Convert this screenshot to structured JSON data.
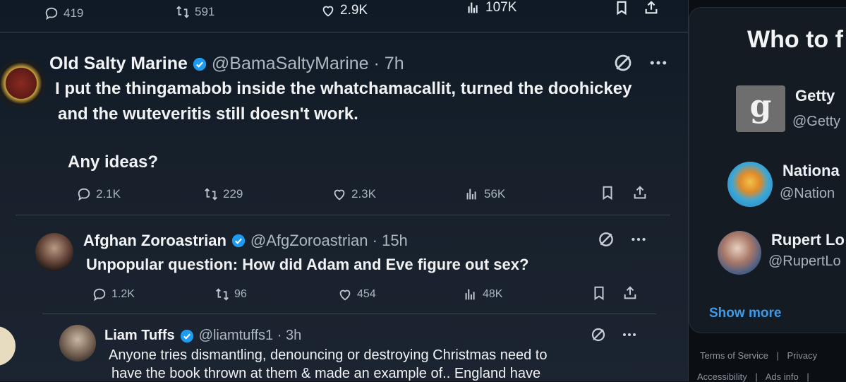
{
  "top_bar": {
    "replies": "419",
    "reposts": "591",
    "likes": "2.9K",
    "views": "107K"
  },
  "tweets": [
    {
      "name": "Old Salty Marine",
      "handle": "@BamaSaltyMarine · 7h",
      "text_line1": "I put the thingamabob inside the whatchamacallit, turned the doohickey",
      "text_line2": "and the wuteveritis still doesn't work.",
      "text_line3": "Any ideas?",
      "replies": "2.1K",
      "reposts": "229",
      "likes": "2.3K",
      "views": "56K"
    },
    {
      "name": "Afghan Zoroastrian",
      "handle": "@AfgZoroastrian · 15h",
      "text_line1": "Unpopular question: How did Adam and Eve figure out sex?",
      "replies": "1.2K",
      "reposts": "96",
      "likes": "454",
      "views": "48K"
    },
    {
      "name": "Liam Tuffs",
      "handle": "@liamtuffs1 · 3h",
      "text_line1": "Anyone tries dismantling, denouncing or destroying Christmas need to",
      "text_line2": "have the book thrown at them & made an example of.. England have"
    }
  ],
  "sidebar": {
    "title": "Who to f",
    "items": [
      {
        "name": "Getty",
        "handle": "@Getty"
      },
      {
        "name": "Nationa",
        "handle": "@Nation"
      },
      {
        "name": "Rupert Lo",
        "handle": "@RupertLo"
      }
    ],
    "show_more": "Show more",
    "footer": {
      "terms": "Terms of Service",
      "privacy": "Privacy",
      "accessibility": "Accessibility",
      "ads": "Ads info",
      "sep": "|"
    }
  },
  "colors": {
    "background": "#17202b",
    "accent_blue": "#3d9ae8",
    "verified": "#1d9bf0"
  }
}
